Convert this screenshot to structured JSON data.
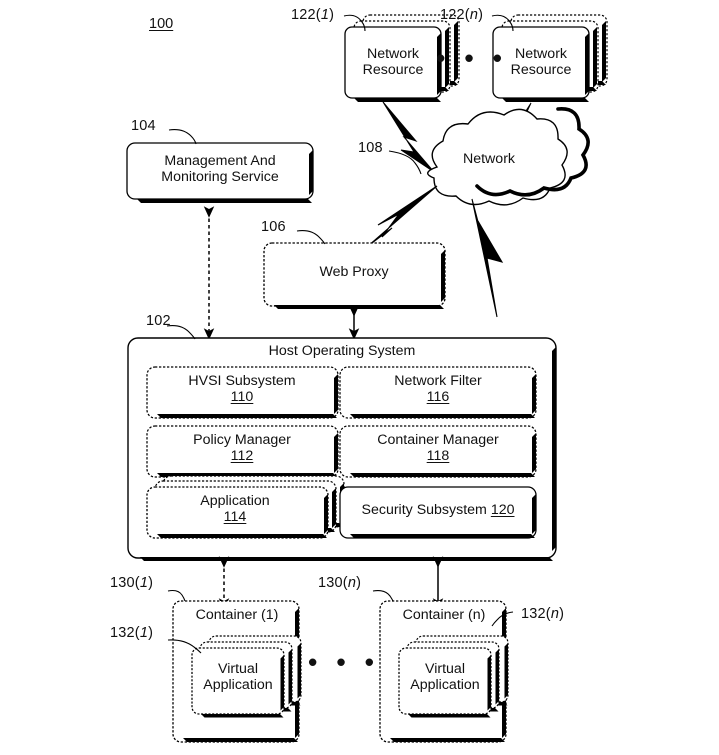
{
  "figure": {
    "number": "100",
    "type": "patent-system-diagram"
  },
  "nodes": {
    "network_resource_1": {
      "label_line1": "Network",
      "label_line2": "Resource",
      "ref": "122(1)",
      "ref_prefix": "122(",
      "ref_index": "1",
      "ref_suffix": ")"
    },
    "network_resource_n": {
      "label_line1": "Network",
      "label_line2": "Resource",
      "ref": "122(n)",
      "ref_prefix": "122(",
      "ref_index": "n",
      "ref_suffix": ")"
    },
    "network_cloud": {
      "label": "Network",
      "ref": "108"
    },
    "management_service": {
      "label_line1": "Management And",
      "label_line2": "Monitoring Service",
      "ref": "104"
    },
    "web_proxy": {
      "label": "Web Proxy",
      "ref": "106"
    },
    "host_os": {
      "title": "Host Operating System",
      "ref": "102"
    },
    "hvsi_subsystem": {
      "label": "HVSI Subsystem",
      "ref": "110"
    },
    "network_filter": {
      "label": "Network Filter",
      "ref": "116"
    },
    "policy_manager": {
      "label": "Policy Manager",
      "ref": "112"
    },
    "container_manager": {
      "label": "Container Manager",
      "ref": "118"
    },
    "application": {
      "label": "Application",
      "ref": "114"
    },
    "security_subsystem": {
      "label": "Security Subsystem",
      "ref": "120",
      "inline_label": "Security Subsystem 120"
    },
    "container_1": {
      "label_prefix": "Container (",
      "label_index": "1",
      "label_suffix": ")",
      "ref": "130(1)",
      "ref_prefix": "130(",
      "ref_index": "1",
      "ref_suffix": ")"
    },
    "container_n": {
      "label_prefix": "Container (",
      "label_index": "n",
      "label_suffix": ")",
      "ref": "130(n)",
      "ref_prefix": "130(",
      "ref_index": "n",
      "ref_suffix": ")"
    },
    "virtual_application_1": {
      "label_line1": "Virtual",
      "label_line2": "Application",
      "ref": "132(1)",
      "ref_prefix": "132(",
      "ref_index": "1",
      "ref_suffix": ")"
    },
    "virtual_application_n": {
      "label_line1": "Virtual",
      "label_line2": "Application",
      "ref": "132(n)",
      "ref_prefix": "132(",
      "ref_index": "n",
      "ref_suffix": ")"
    }
  },
  "ellipsis": {
    "top": "• • •",
    "bottom": "• • •"
  },
  "colors": {
    "stroke": "#000000",
    "fill": "#ffffff",
    "background": "#ffffff"
  }
}
